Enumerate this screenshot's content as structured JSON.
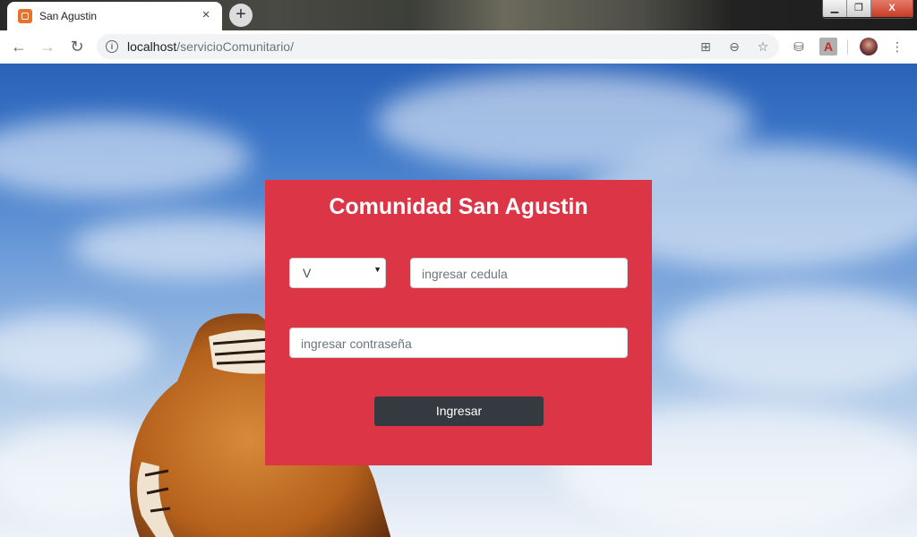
{
  "browser": {
    "tab_title": "San Agustin",
    "tab_close": "×",
    "new_tab": "+",
    "window_controls": {
      "minimize": "▁",
      "maximize": "❐",
      "close": "X"
    },
    "url_host": "localhost",
    "url_path": "/servicioComunitario/",
    "icons": [
      "back-icon",
      "forward-icon",
      "reload-icon",
      "info-icon",
      "translate-icon",
      "zoom-out-icon",
      "star-icon",
      "shopping-bag-icon",
      "pdf-icon",
      "avatar",
      "menu-icon"
    ]
  },
  "page": {
    "title": "Comunidad San Agustin",
    "document_type": {
      "selected": "V"
    },
    "cedula_placeholder": "ingresar cedula",
    "password_placeholder": "ingresar contraseña",
    "submit_label": "Ingresar"
  },
  "colors": {
    "panel": "#dc3545",
    "button": "#343a40"
  }
}
